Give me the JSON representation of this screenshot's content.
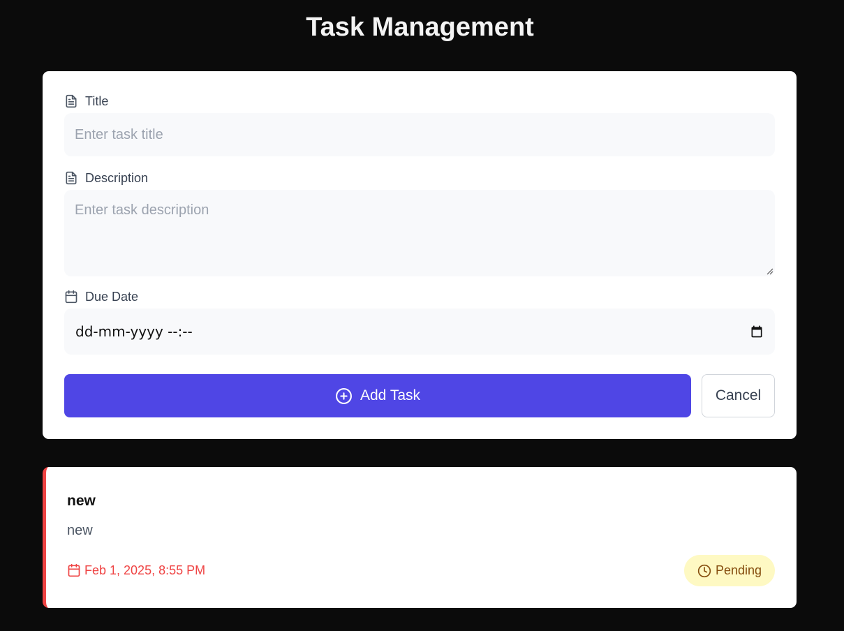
{
  "header": {
    "title": "Task Management"
  },
  "form": {
    "title_label": "Title",
    "title_placeholder": "Enter task title",
    "description_label": "Description",
    "description_placeholder": "Enter task description",
    "due_date_label": "Due Date",
    "due_date_value": "dd-mm-yyyy --:--",
    "add_button": "Add Task",
    "cancel_button": "Cancel"
  },
  "tasks": [
    {
      "title": "new",
      "description": "new",
      "due": "Feb 1, 2025, 8:55 PM",
      "status": "Pending"
    }
  ],
  "icons": {
    "title": "file-text-icon",
    "description": "file-text-icon",
    "due_date": "calendar-icon",
    "date_picker": "calendar-icon",
    "add": "plus-circle-icon",
    "task_due": "calendar-icon",
    "status": "clock-icon"
  },
  "colors": {
    "background": "#0b0b0b",
    "accent": "#4f46e5",
    "overdue": "#ef4444",
    "pending_bg": "#fef9c3",
    "pending_text": "#854d0e"
  }
}
